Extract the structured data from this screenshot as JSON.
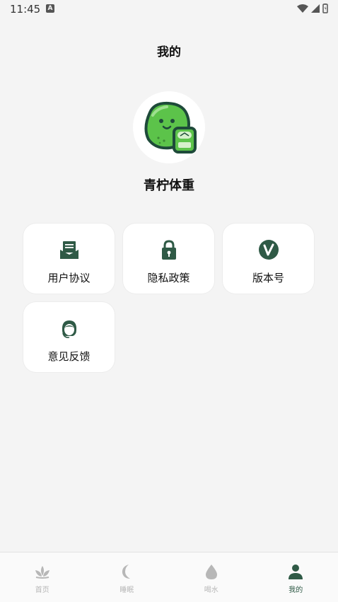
{
  "status": {
    "time": "11:45",
    "notif_letter": "A"
  },
  "header": {
    "title": "我的"
  },
  "profile": {
    "app_name": "青柠体重"
  },
  "menu": [
    {
      "label": "用户协议",
      "icon": "document-icon"
    },
    {
      "label": "隐私政策",
      "icon": "lock-icon"
    },
    {
      "label": "版本号",
      "icon": "version-icon"
    },
    {
      "label": "意见反馈",
      "icon": "support-icon"
    }
  ],
  "nav": [
    {
      "label": "首页",
      "icon": "lotus-icon",
      "active": false
    },
    {
      "label": "睡眠",
      "icon": "moon-icon",
      "active": false
    },
    {
      "label": "喝水",
      "icon": "water-drop-icon",
      "active": false
    },
    {
      "label": "我的",
      "icon": "user-icon",
      "active": true
    }
  ],
  "colors": {
    "accent": "#2f5a46",
    "inactive": "#b7b7b7",
    "lime": "#5cc34a"
  }
}
